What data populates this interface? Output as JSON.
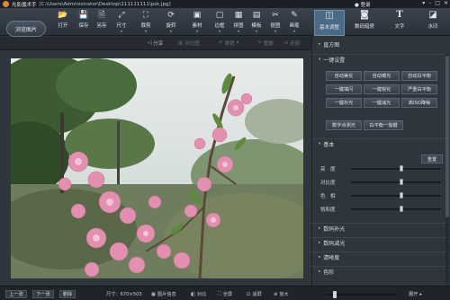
{
  "titlebar": {
    "app_name": "光影魔术手",
    "file_path": "[C:\\Users\\Administrator\\Desktop\\111111111\\psk.jpg]",
    "login_label": "登录",
    "window_controls": [
      "▾",
      "–",
      "□",
      "✕"
    ]
  },
  "toolbar": {
    "open_image_label": "浏览图片",
    "tools": [
      {
        "label": "打开",
        "icon": "open-folder-icon",
        "glyph": "📂",
        "dropdown": false
      },
      {
        "label": "保存",
        "icon": "save-icon",
        "glyph": "💾",
        "dropdown": false
      },
      {
        "label": "另存",
        "icon": "save-as-icon",
        "glyph": "🗎",
        "dropdown": false
      },
      {
        "label": "尺寸",
        "icon": "resize-icon",
        "glyph": "⤢",
        "dropdown": true
      },
      {
        "label": "裁剪",
        "icon": "crop-icon",
        "glyph": "⛶",
        "dropdown": true
      },
      {
        "label": "旋转",
        "icon": "rotate-icon",
        "glyph": "⟳",
        "dropdown": true
      },
      {
        "label": "素材",
        "icon": "material-icon",
        "glyph": "▣",
        "dropdown": true
      },
      {
        "label": "边框",
        "icon": "border-icon",
        "glyph": "▢",
        "dropdown": true
      },
      {
        "label": "拼图",
        "icon": "collage-icon",
        "glyph": "▦",
        "dropdown": true
      },
      {
        "label": "模板",
        "icon": "template-icon",
        "glyph": "▤",
        "dropdown": true
      },
      {
        "label": "抠图",
        "icon": "cutout-icon",
        "glyph": "✂",
        "dropdown": true
      },
      {
        "label": "画笔",
        "icon": "brush-icon",
        "glyph": "✎",
        "dropdown": true
      }
    ]
  },
  "right_tabs": [
    {
      "label": "基本调整",
      "icon": "basic-adjust-icon",
      "glyph": "◫",
      "active": true
    },
    {
      "label": "数码暗房",
      "icon": "darkroom-icon",
      "glyph": "📷",
      "active": false
    },
    {
      "label": "文字",
      "icon": "text-icon",
      "glyph": "T",
      "active": false
    },
    {
      "label": "水印",
      "icon": "watermark-icon",
      "glyph": "◪",
      "active": false
    }
  ],
  "subbar": {
    "share": "分享",
    "compare": "对比图",
    "undo": "撤销",
    "redo": "重做",
    "restore": "还原"
  },
  "panel": {
    "histogram": "直方图",
    "one_click": "一键设置",
    "one_click_buttons": [
      "自动美化",
      "自动曝光",
      "自动白平衡",
      "一键填闪",
      "一键锐化",
      "严重白平衡",
      "一键补光",
      "一键减光",
      "高ISO降噪"
    ],
    "extra_buttons": [
      "数字点测光",
      "白平衡一指键"
    ],
    "basic": "基本",
    "reset": "重置",
    "sliders": [
      {
        "label": "亮　度",
        "value": 0.56
      },
      {
        "label": "对比度",
        "value": 0.56
      },
      {
        "label": "色　相",
        "value": 0.56
      },
      {
        "label": "饱和度",
        "value": 0.56
      }
    ],
    "sections": [
      "数码补光",
      "数码减光",
      "清晰度",
      "色阶",
      "曲线"
    ]
  },
  "statusbar": {
    "prev": "上一张",
    "next": "下一张",
    "delete": "删除",
    "size": "尺寸：670×503",
    "image_info": "图片信息",
    "compare": "对比",
    "fullscreen": "全屏",
    "fit": "适屏",
    "zoom_in": "放大",
    "zoom_value": 0.1,
    "expand": "展开"
  }
}
